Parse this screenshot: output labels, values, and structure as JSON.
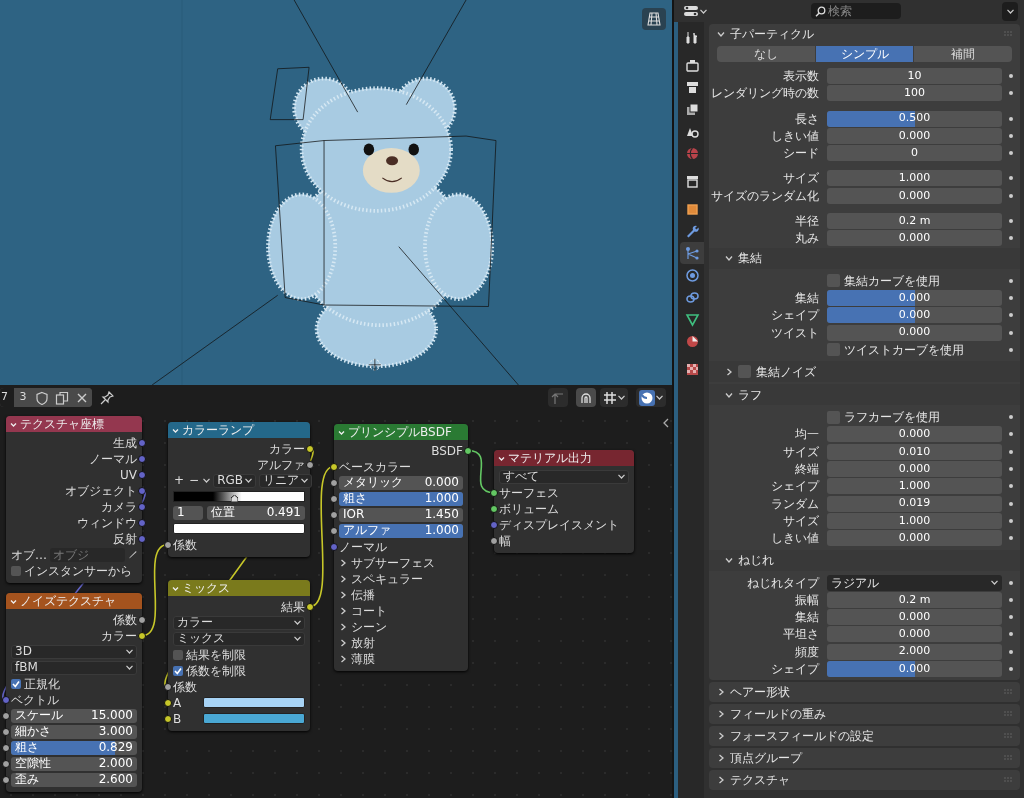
{
  "node_editor": {
    "header": {
      "material_name": "7",
      "users": "3"
    },
    "nodes": [
      {
        "title": "テクスチャ座標",
        "color": "#94374f",
        "items": [
          {
            "kind": "output",
            "label": "生成",
            "color": "#6363c7"
          },
          {
            "kind": "output",
            "label": "ノーマル",
            "color": "#6363c7"
          },
          {
            "kind": "output",
            "label": "UV",
            "color": "#6363c7"
          },
          {
            "kind": "output",
            "label": "オブジェクト",
            "color": "#6363c7"
          },
          {
            "kind": "output",
            "label": "カメラ",
            "color": "#6363c7"
          },
          {
            "kind": "output",
            "label": "ウィンドウ",
            "color": "#6363c7"
          },
          {
            "kind": "output",
            "label": "反射",
            "color": "#6363c7"
          },
          {
            "kind": "object_field",
            "label": "オブ…",
            "placeholder": "オブジ"
          },
          {
            "kind": "checkbox",
            "label": "インスタンサーから",
            "checked": false
          }
        ]
      },
      {
        "title": "ノイズテクスチャ",
        "color": "#a4531e",
        "items": [
          {
            "kind": "output",
            "label": "係数",
            "color": "#a1a1a1"
          },
          {
            "kind": "output",
            "label": "カラー",
            "color": "#c7c729"
          },
          {
            "kind": "dropdown",
            "value": "3D"
          },
          {
            "kind": "dropdown",
            "value": "fBM"
          },
          {
            "kind": "checkbox",
            "label": "正規化",
            "checked": true
          },
          {
            "kind": "input",
            "label": "ベクトル",
            "color": "#6363c7"
          },
          {
            "kind": "field",
            "label": "スケール",
            "value": "15.000",
            "color": "#a1a1a1"
          },
          {
            "kind": "field",
            "label": "細かさ",
            "value": "3.000",
            "color": "#a1a1a1"
          },
          {
            "kind": "slider",
            "label": "粗さ",
            "value": "0.829",
            "level": 0.829,
            "color": "#a1a1a1"
          },
          {
            "kind": "field",
            "label": "空隙性",
            "value": "2.000",
            "color": "#a1a1a1"
          },
          {
            "kind": "field",
            "label": "歪み",
            "value": "2.600",
            "color": "#a1a1a1"
          }
        ]
      },
      {
        "title": "カラーランプ",
        "color": "#24688a",
        "items": [
          {
            "kind": "output",
            "label": "カラー",
            "color": "#c7c729"
          },
          {
            "kind": "output",
            "label": "アルファ",
            "color": "#a1a1a1"
          },
          {
            "kind": "ramp_tools",
            "buttons": [
              "+",
              "−"
            ],
            "color_mode": "RGB",
            "interpolation": "リニア"
          },
          {
            "kind": "gradient"
          },
          {
            "kind": "ramp_stop",
            "index": "1",
            "label": "位置",
            "value": "0.491"
          },
          {
            "kind": "swatch",
            "swatch": {
              "color": "#ffffff"
            }
          },
          {
            "kind": "input",
            "label": "係数",
            "color": "#a1a1a1"
          }
        ]
      },
      {
        "title": "ミックス",
        "color": "#7a7a1c",
        "items": [
          {
            "kind": "output",
            "label": "結果",
            "color": "#c7c729"
          },
          {
            "kind": "dropdown",
            "value": "カラー"
          },
          {
            "kind": "dropdown",
            "value": "ミックス"
          },
          {
            "kind": "checkbox",
            "label": "結果を制限",
            "checked": false
          },
          {
            "kind": "checkbox",
            "label": "係数を制限",
            "checked": true
          },
          {
            "kind": "input",
            "label": "係数",
            "color": "#a1a1a1"
          },
          {
            "kind": "swatch",
            "label": "A",
            "color": "#c7c729",
            "swatch": {
              "color": "#a7d3f5"
            }
          },
          {
            "kind": "swatch",
            "label": "B",
            "color": "#c7c729",
            "swatch": {
              "color": "#4aa8d4"
            }
          }
        ]
      },
      {
        "title": "プリンシプルBSDF",
        "color": "#2a7a33",
        "items": [
          {
            "kind": "output",
            "label": "BSDF",
            "color": "#63c763"
          },
          {
            "kind": "input",
            "label": "ベースカラー",
            "color": "#c7c729"
          },
          {
            "kind": "field",
            "label": "メタリック",
            "value": "0.000",
            "color": "#a1a1a1"
          },
          {
            "kind": "slider",
            "label": "粗さ",
            "value": "1.000",
            "level": 1,
            "color": "#a1a1a1"
          },
          {
            "kind": "field",
            "label": "IOR",
            "value": "1.450",
            "color": "#a1a1a1"
          },
          {
            "kind": "slider",
            "label": "アルファ",
            "value": "1.000",
            "level": 1,
            "color": "#a1a1a1"
          },
          {
            "kind": "input",
            "label": "ノーマル",
            "color": "#6363c7"
          },
          {
            "kind": "panel",
            "label": "サブサーフェス",
            "expanded": false
          },
          {
            "kind": "panel",
            "label": "スペキュラー",
            "expanded": false
          },
          {
            "kind": "panel",
            "label": "伝播",
            "expanded": false
          },
          {
            "kind": "panel",
            "label": "コート",
            "expanded": false
          },
          {
            "kind": "panel",
            "label": "シーン",
            "expanded": false
          },
          {
            "kind": "panel",
            "label": "放射",
            "expanded": false
          },
          {
            "kind": "panel",
            "label": "薄膜",
            "expanded": false
          }
        ]
      },
      {
        "title": "マテリアル出力",
        "color": "#772630",
        "items": [
          {
            "kind": "dropdown",
            "value": "すべて"
          },
          {
            "kind": "input",
            "label": "サーフェス",
            "color": "#63c763"
          },
          {
            "kind": "input",
            "label": "ボリューム",
            "color": "#63c763"
          },
          {
            "kind": "input",
            "label": "ディスプレイスメント",
            "color": "#6363c7"
          },
          {
            "kind": "input",
            "label": "幅",
            "color": "#a1a1a1"
          }
        ]
      }
    ]
  },
  "properties": {
    "search": {
      "placeholder": "検索"
    },
    "tabs": [
      {
        "kind": "tool",
        "selected": false
      },
      {
        "kind": "render",
        "selected": false
      },
      {
        "kind": "output",
        "selected": false
      },
      {
        "kind": "view_layer",
        "selected": false
      },
      {
        "kind": "scene",
        "selected": false
      },
      {
        "kind": "world",
        "selected": false
      },
      {
        "kind": "collection",
        "selected": false
      },
      {
        "kind": "object",
        "selected": false
      },
      {
        "kind": "modifier",
        "selected": false
      },
      {
        "kind": "particles",
        "selected": true
      },
      {
        "kind": "physics",
        "selected": false
      },
      {
        "kind": "constraints",
        "selected": false
      },
      {
        "kind": "data",
        "selected": false
      },
      {
        "kind": "material",
        "selected": false
      },
      {
        "kind": "texture",
        "selected": false
      }
    ],
    "panel": {
      "title": "子パーティクル",
      "expanded": true,
      "modes": [
        {
          "label": "なし",
          "selected": false
        },
        {
          "label": "シンプル",
          "selected": true
        },
        {
          "label": "補間",
          "selected": false
        }
      ],
      "rows": [
        {
          "kind": "number",
          "label": "表示数",
          "value": "10"
        },
        {
          "kind": "number",
          "label": "レンダリング時の数",
          "value": "100"
        },
        {
          "kind": "spacer"
        },
        {
          "kind": "slider",
          "label": "長さ",
          "value": "0.500",
          "level": 0.5
        },
        {
          "kind": "number",
          "label": "しきい値",
          "value": "0.000"
        },
        {
          "kind": "number",
          "label": "シード",
          "value": "0"
        },
        {
          "kind": "spacer"
        },
        {
          "kind": "number",
          "label": "サイズ",
          "value": "1.000"
        },
        {
          "kind": "number",
          "label": "サイズのランダム化",
          "value": "0.000"
        },
        {
          "kind": "spacer"
        },
        {
          "kind": "number",
          "label": "半径",
          "value": "0.2 m"
        },
        {
          "kind": "number",
          "label": "丸み",
          "value": "0.000"
        }
      ],
      "subpanels": [
        {
          "title": "集結",
          "expanded": true,
          "rows": [
            {
              "kind": "checkbox",
              "label": "集結カーブを使用",
              "checked": false
            },
            {
              "kind": "slider",
              "label": "集結",
              "value": "0.000",
              "level": 0.5
            },
            {
              "kind": "slider",
              "label": "シェイプ",
              "value": "0.000",
              "level": 0.5
            },
            {
              "kind": "number",
              "label": "ツイスト",
              "value": "0.000"
            },
            {
              "kind": "checkbox",
              "label": "ツイストカーブを使用",
              "checked": false
            }
          ]
        },
        {
          "title": "集結ノイズ",
          "expanded": false,
          "checked": false
        },
        {
          "title": "ラフ",
          "expanded": true,
          "rows": [
            {
              "kind": "checkbox",
              "label": "ラフカーブを使用",
              "checked": false
            },
            {
              "kind": "number",
              "label": "均一",
              "value": "0.000"
            },
            {
              "kind": "number",
              "label": "サイズ",
              "value": "0.010"
            },
            {
              "kind": "number",
              "label": "終端",
              "value": "0.000"
            },
            {
              "kind": "number",
              "label": "シェイプ",
              "value": "1.000"
            },
            {
              "kind": "number",
              "label": "ランダム",
              "value": "0.019"
            },
            {
              "kind": "number",
              "label": "サイズ",
              "value": "1.000"
            },
            {
              "kind": "number",
              "label": "しきい値",
              "value": "0.000"
            }
          ]
        },
        {
          "title": "ねじれ",
          "expanded": true,
          "rows": [
            {
              "kind": "dropdown",
              "label": "ねじれタイプ",
              "value": "ラジアル"
            },
            {
              "kind": "number",
              "label": "振幅",
              "value": "0.2 m"
            },
            {
              "kind": "number",
              "label": "集結",
              "value": "0.000"
            },
            {
              "kind": "number",
              "label": "平坦さ",
              "value": "0.000"
            },
            {
              "kind": "number",
              "label": "頻度",
              "value": "2.000"
            },
            {
              "kind": "slider",
              "label": "シェイプ",
              "value": "0.000",
              "level": 0.5
            }
          ]
        }
      ]
    },
    "collapsed_panels": [
      {
        "title": "ヘアー形状",
        "expanded": false
      },
      {
        "title": "フィールドの重み",
        "expanded": false
      },
      {
        "title": "フォースフィールドの設定",
        "expanded": false
      },
      {
        "title": "頂点グループ",
        "expanded": false
      },
      {
        "title": "テクスチャ",
        "expanded": false
      }
    ]
  }
}
